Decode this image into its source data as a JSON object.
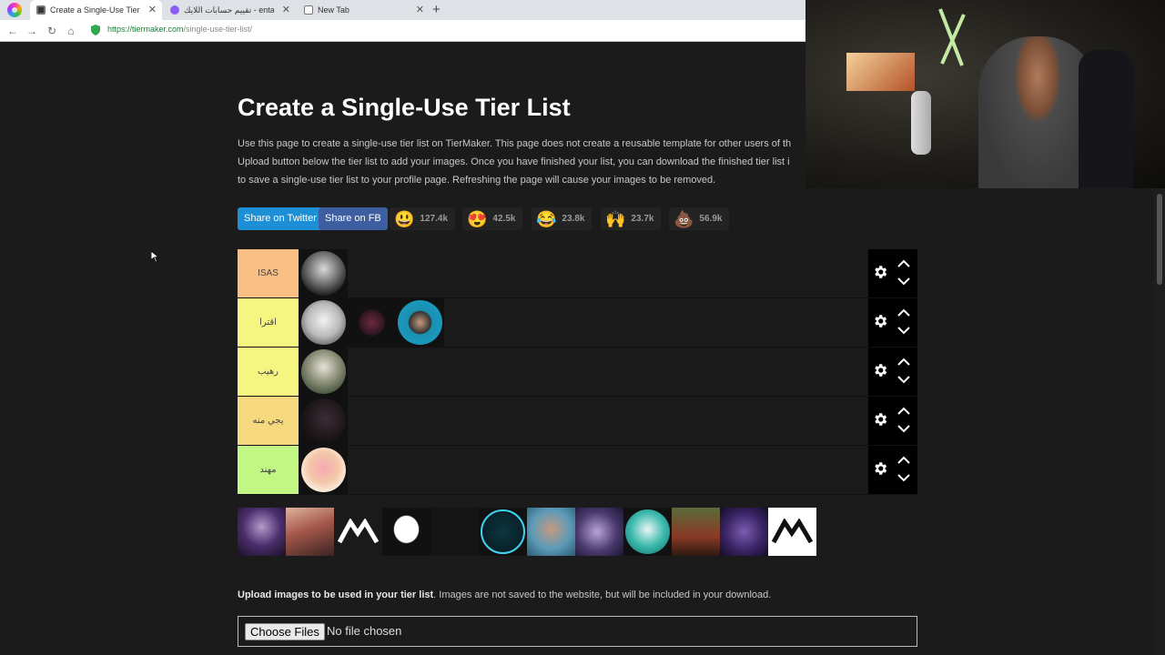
{
  "browser": {
    "tabs": [
      {
        "title": "Create a Single-Use Tier List (…",
        "active": true
      },
      {
        "title": "تقييم حسابات اللايك - entation"
      },
      {
        "title": "New Tab"
      }
    ],
    "new_tab_label": "+",
    "url_scheme": "https://",
    "url_host": "tiermaker.com",
    "url_path": "/single-use-tier-list/"
  },
  "page": {
    "title": "Create a Single-Use Tier List",
    "intro_lines": [
      "Use this page to create a single-use tier list on TierMaker. This page does not create a reusable template for other users of th",
      "Upload button below the tier list to add your images. Once you have finished your list, you can download the finished tier list i",
      "to save a single-use tier list to your profile page. Refreshing the page will cause your images to be removed."
    ],
    "share_twitter": "Share on Twitter",
    "share_fb": "Share on FB",
    "reactions": [
      {
        "icon": "smiley-icon",
        "emoji": "😃",
        "count": "127.4k"
      },
      {
        "icon": "heart-eyes-icon",
        "emoji": "😍",
        "count": "42.5k"
      },
      {
        "icon": "laughing-icon",
        "emoji": "😂",
        "count": "23.8k"
      },
      {
        "icon": "raised-hands-icon",
        "emoji": "🙌",
        "count": "23.7k"
      },
      {
        "icon": "poop-icon",
        "emoji": "💩",
        "count": "56.9k"
      }
    ],
    "tiers": [
      {
        "label": "ISAS",
        "color": "#f9bf82"
      },
      {
        "label": "اقترا",
        "color": "#f7f582"
      },
      {
        "label": "رهيب",
        "color": "#f7f582"
      },
      {
        "label": "يجي منه",
        "color": "#f6d87f"
      },
      {
        "label": "مهند",
        "color": "#c2f784"
      }
    ],
    "upload_bold": "Upload images to be used in your tier list",
    "upload_rest": ". Images are not saved to the website, but will be included in your download.",
    "choose_files": "Choose Files",
    "no_file": "No file chosen"
  }
}
